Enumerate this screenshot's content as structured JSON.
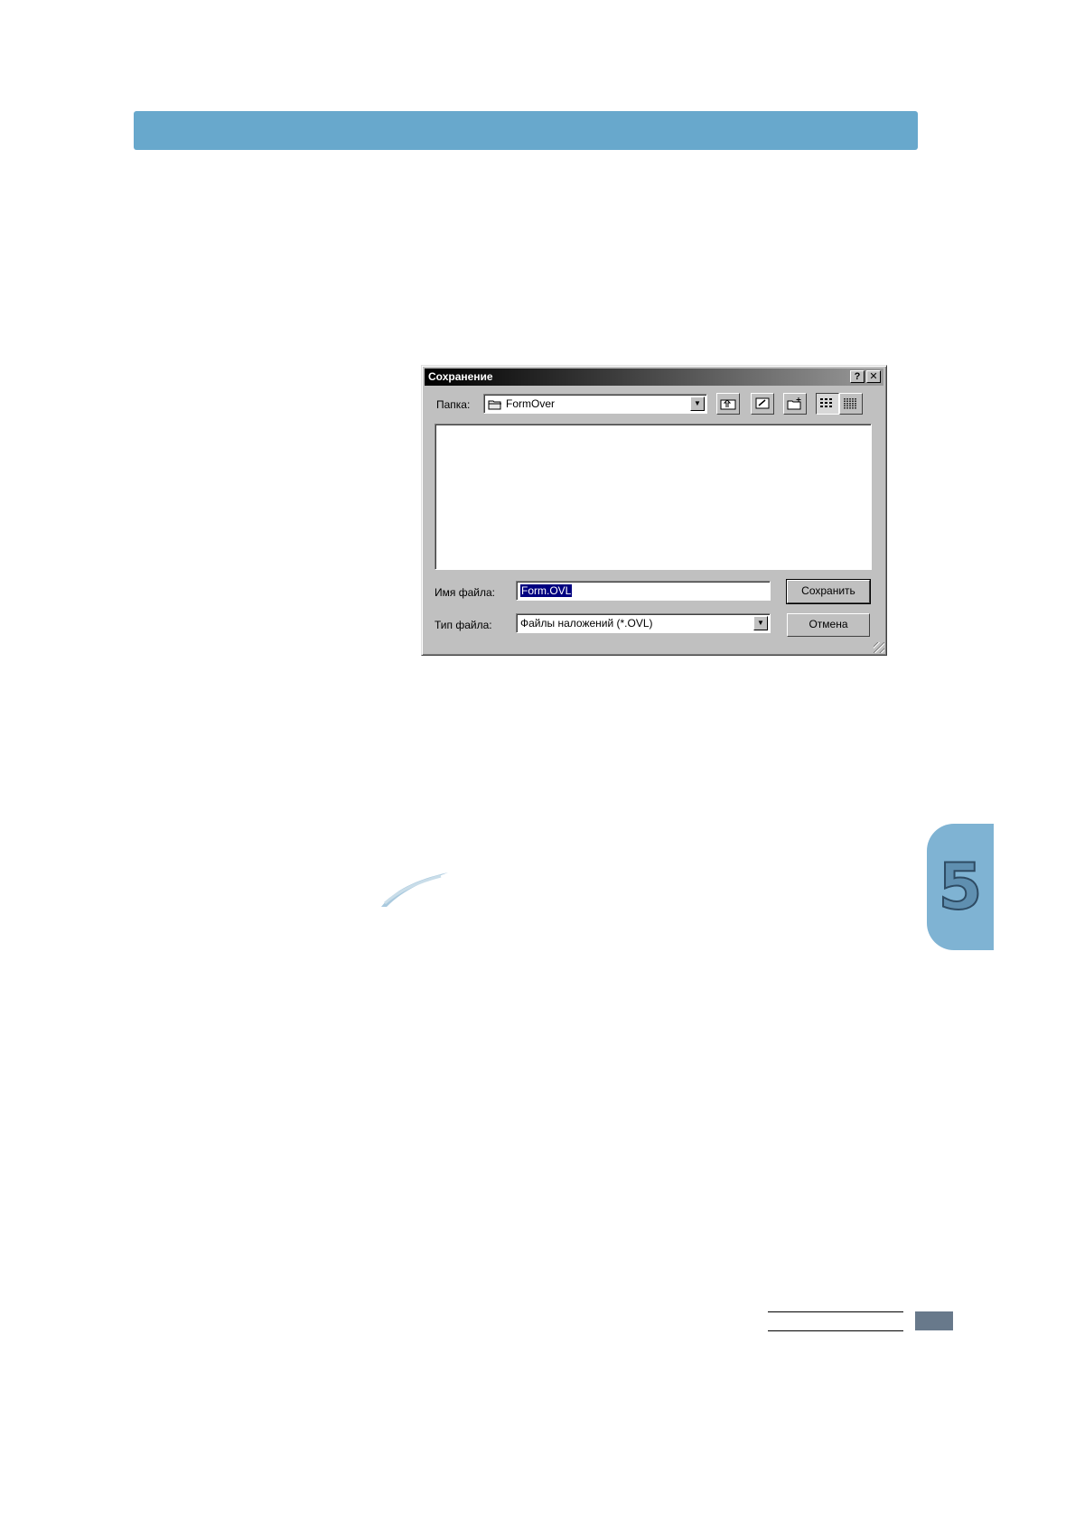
{
  "dialog": {
    "title": "Сохранение",
    "help_button": "?",
    "close_button": "✕",
    "folder_label": "Папка:",
    "folder_value": "FormOver",
    "filename_label": "Имя файла:",
    "filename_value": "Form.OVL",
    "filetype_label": "Тип файла:",
    "filetype_value": "Файлы наложений (*.OVL)",
    "save_button": "Сохранить",
    "cancel_button": "Отмена",
    "toolbar_icons": [
      "up-folder-icon",
      "desktop-icon",
      "new-folder-icon",
      "list-view-icon",
      "details-view-icon"
    ]
  },
  "page": {
    "chapter_number": "5",
    "header_color": "#68a8cc",
    "tab_color": "#7fb3d3"
  }
}
